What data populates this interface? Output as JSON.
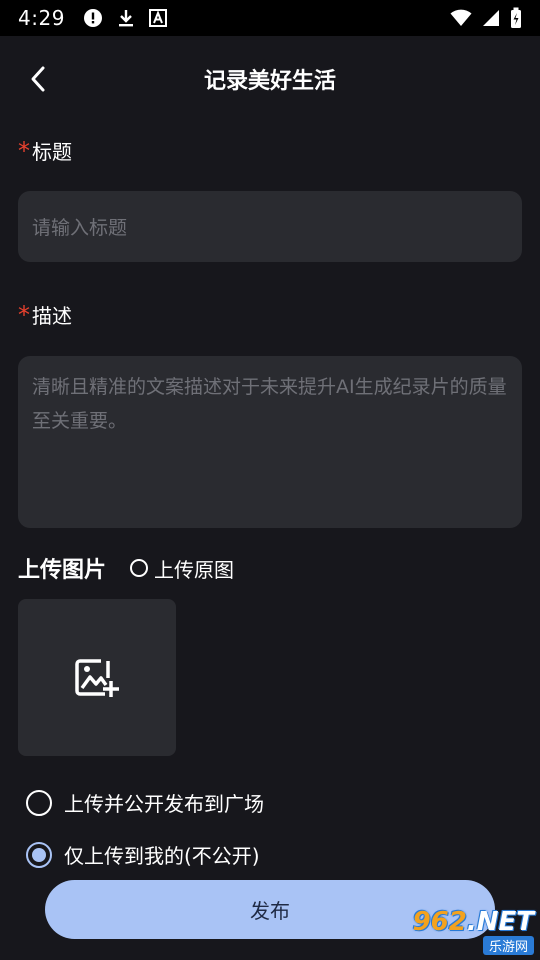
{
  "status_bar": {
    "time": "4:29",
    "left_icons": [
      "alert-icon",
      "download-icon",
      "a-badge-icon"
    ],
    "right_icons": [
      "wifi-icon",
      "signal-icon",
      "battery-icon"
    ]
  },
  "header": {
    "title": "记录美好生活",
    "back_icon": "chevron-left-icon"
  },
  "form": {
    "required_mark": "*",
    "title_label": "标题",
    "title_placeholder": "请输入标题",
    "desc_label": "描述",
    "desc_placeholder": "清晰且精准的文案描述对于未来提升AI生成纪录片的质量至关重要。",
    "upload_heading": "上传图片",
    "original_label": "上传原图",
    "original_checked": false,
    "image_picker_icon": "add-photo-icon"
  },
  "visibility": {
    "options": [
      {
        "label": "上传并公开发布到广场",
        "checked": false
      },
      {
        "label": "仅上传到我的(不公开)",
        "checked": true
      }
    ]
  },
  "actions": {
    "publish_label": "发布"
  },
  "watermark": {
    "main_prefix": "",
    "main_num": "962",
    "main_suffix": ".NET",
    "sub": "乐游网"
  },
  "colors": {
    "background": "#17171c",
    "field_bg": "#2a2b30",
    "accent": "#a9c3f5",
    "required": "#e8412e",
    "placeholder": "#6f7077"
  }
}
